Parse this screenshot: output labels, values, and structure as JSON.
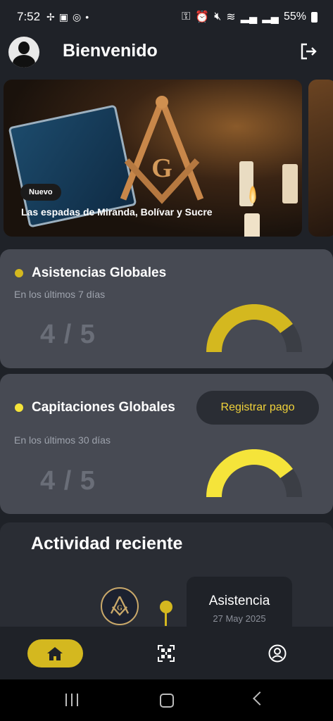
{
  "status_bar": {
    "time": "7:52",
    "battery": "55%"
  },
  "header": {
    "title": "Bienvenido"
  },
  "banner": {
    "badge": "Nuevo",
    "title": "Las espadas de Miranda, Bolívar y Sucre"
  },
  "attendance_card": {
    "title": "Asistencias Globales",
    "subtitle": "En los últimos 7 días",
    "score": "4 / 5",
    "accent": "#d4b81f",
    "progress": 0.8
  },
  "capitation_card": {
    "title": "Capitaciones Globales",
    "subtitle": "En los últimos 30 días",
    "score": "4 / 5",
    "button_label": "Registrar pago",
    "accent": "#f5e43a",
    "progress": 0.8
  },
  "recent_activity": {
    "title": "Actividad reciente",
    "event_type": "Asistencia",
    "event_date": "27 May 2025"
  },
  "bottom_nav": {
    "items": [
      "home-icon",
      "qr-scan-icon",
      "profile-icon"
    ]
  }
}
